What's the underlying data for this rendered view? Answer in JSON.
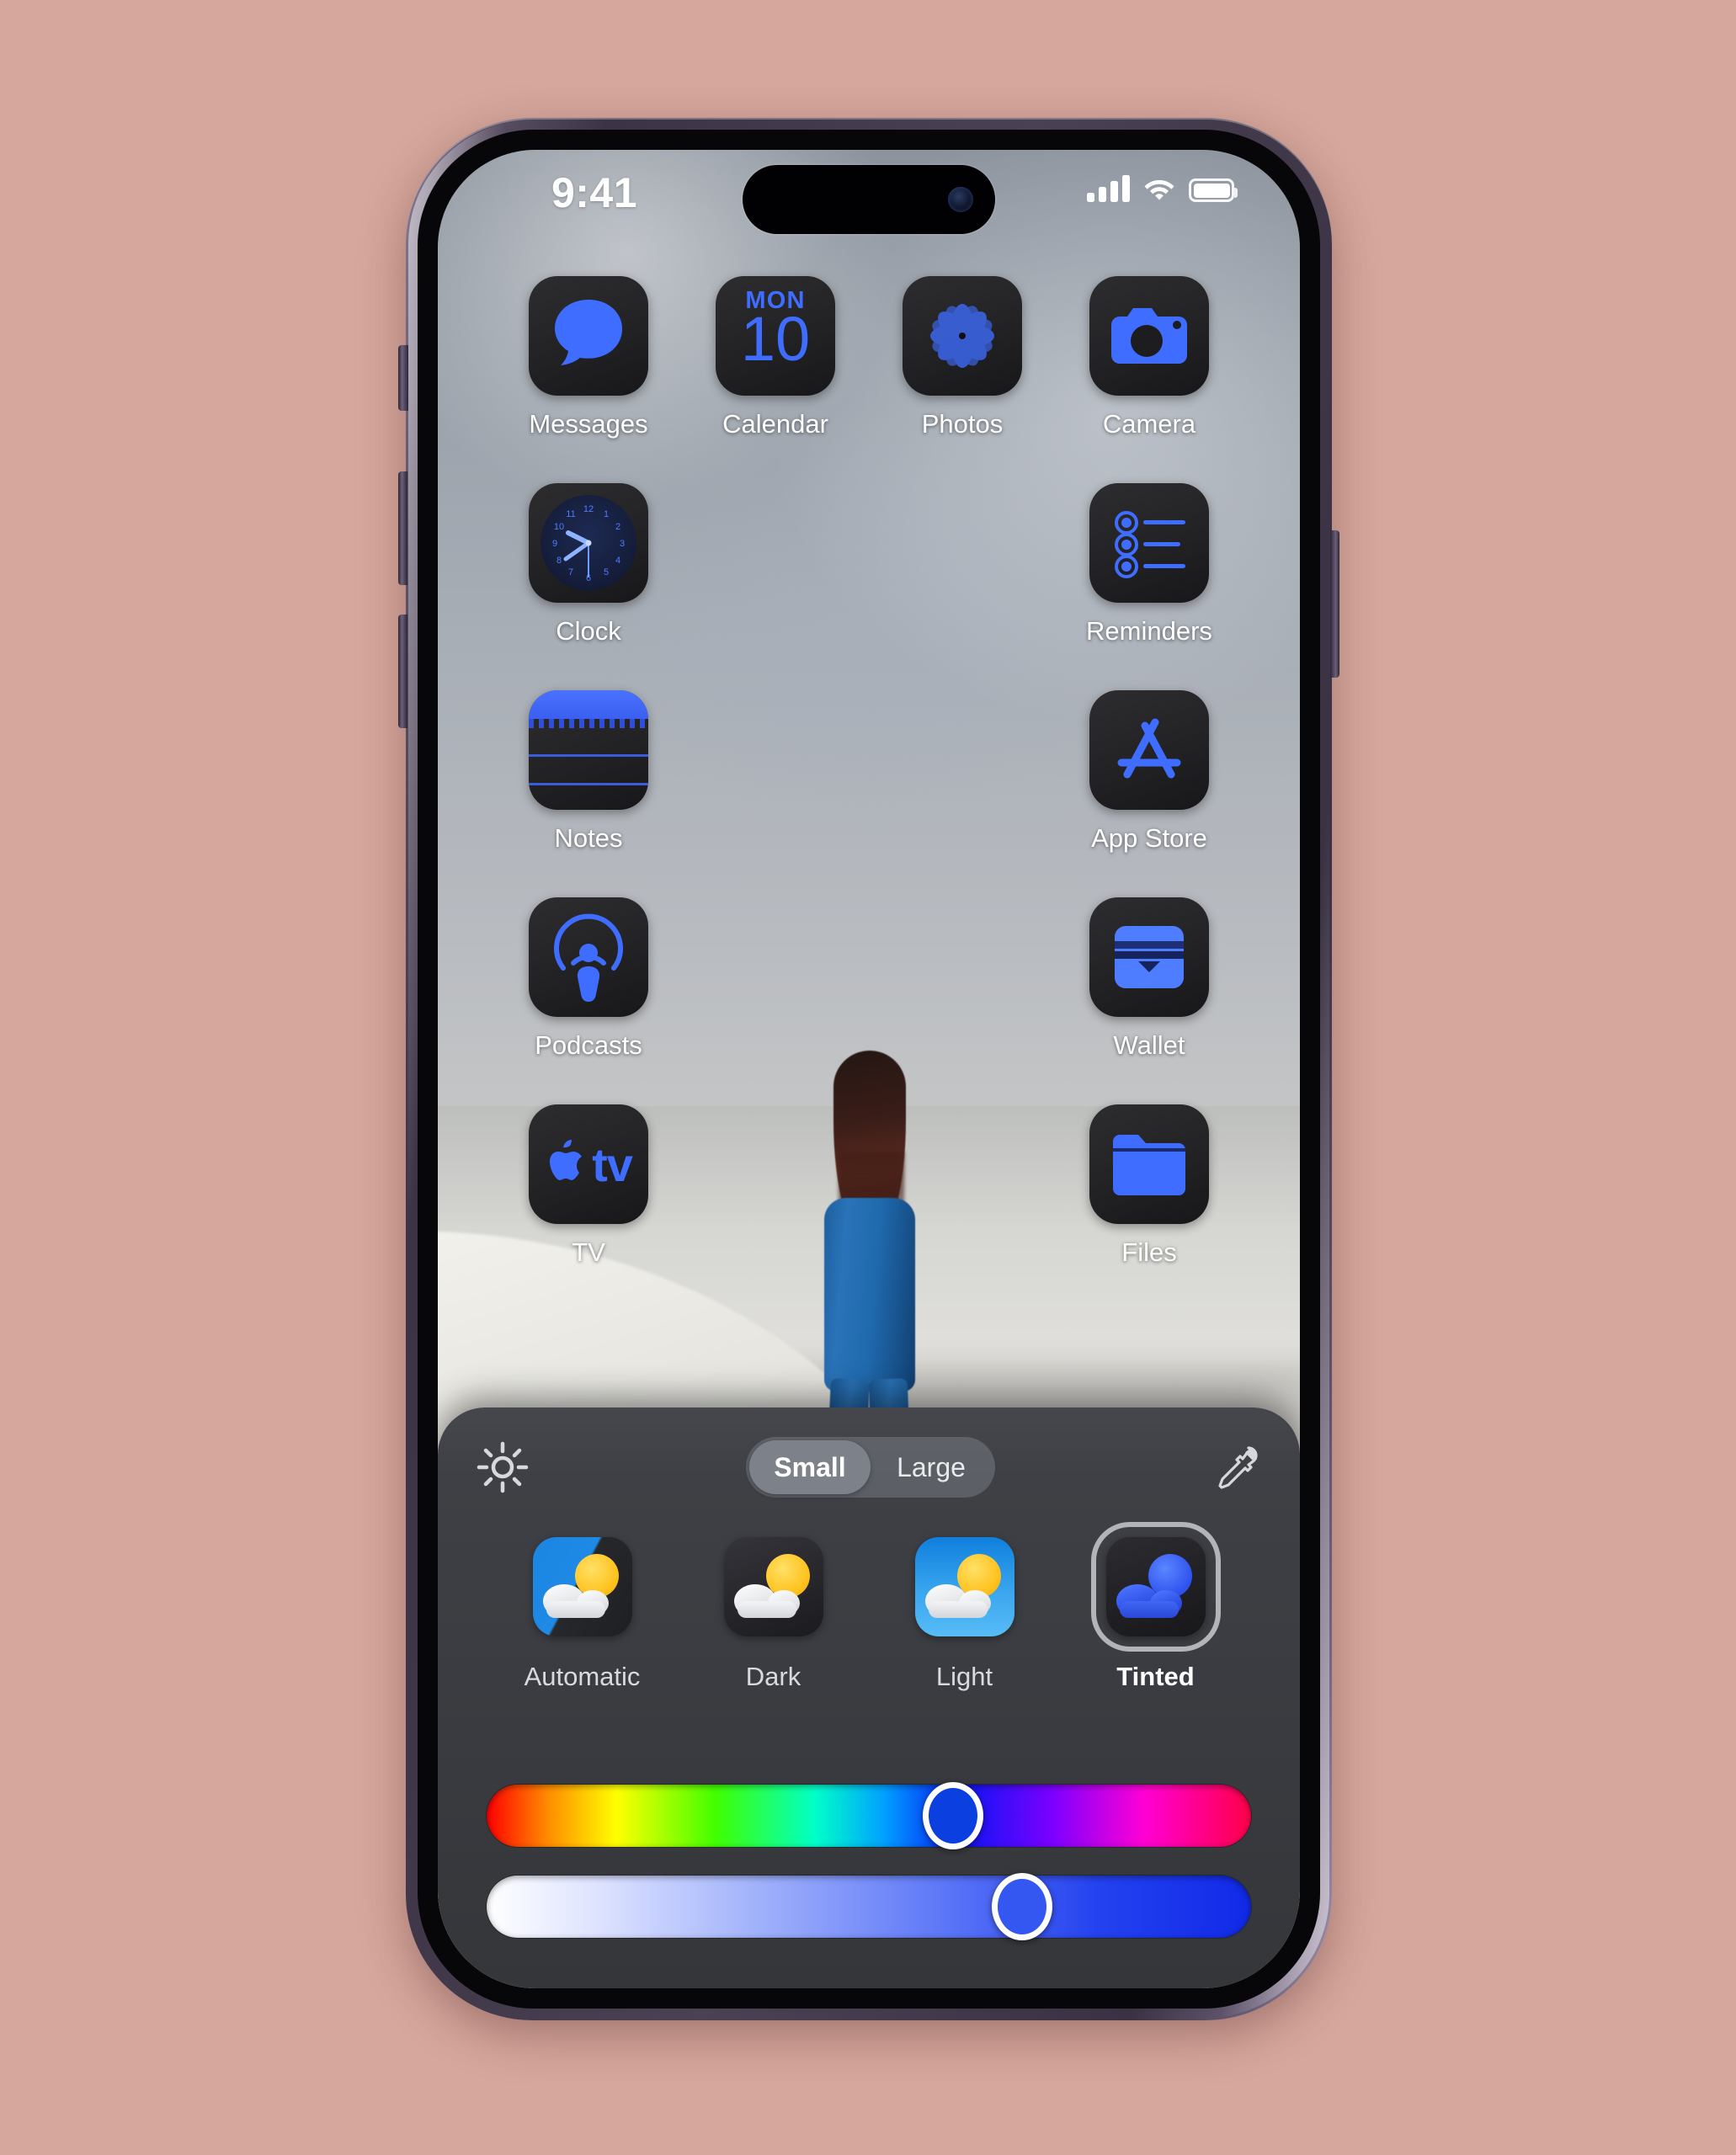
{
  "page": {
    "background_color": "#d6a79c",
    "device": "iPhone",
    "frame_color": "#3c3445"
  },
  "status_bar": {
    "time": "9:41",
    "signal_icon": "cellular-bars-icon",
    "wifi_icon": "wifi-icon",
    "battery_icon": "battery-full-icon",
    "battery_level": 100
  },
  "home_screen": {
    "wallpaper_description": "Person in blue suit walking on white sand dunes under cloudy sky",
    "icon_appearance": "Tinted",
    "accent_color": "#3f6dff",
    "rows": [
      [
        {
          "label": "Messages",
          "icon": "messages-icon"
        },
        {
          "label": "Calendar",
          "icon": "calendar-icon",
          "day_of_week": "MON",
          "day_number": "10"
        },
        {
          "label": "Photos",
          "icon": "photos-icon"
        },
        {
          "label": "Camera",
          "icon": "camera-icon"
        }
      ],
      [
        {
          "label": "Clock",
          "icon": "clock-icon"
        },
        {
          "label": "",
          "icon": ""
        },
        {
          "label": "",
          "icon": ""
        },
        {
          "label": "Reminders",
          "icon": "reminders-icon"
        }
      ],
      [
        {
          "label": "Notes",
          "icon": "notes-icon"
        },
        {
          "label": "",
          "icon": ""
        },
        {
          "label": "",
          "icon": ""
        },
        {
          "label": "App Store",
          "icon": "app-store-icon"
        }
      ],
      [
        {
          "label": "Podcasts",
          "icon": "podcasts-icon"
        },
        {
          "label": "",
          "icon": ""
        },
        {
          "label": "",
          "icon": ""
        },
        {
          "label": "Wallet",
          "icon": "wallet-icon"
        }
      ],
      [
        {
          "label": "TV",
          "icon": "apple-tv-icon",
          "apple_glyph": "",
          "word": "tv"
        },
        {
          "label": "",
          "icon": ""
        },
        {
          "label": "",
          "icon": ""
        },
        {
          "label": "Files",
          "icon": "files-icon"
        }
      ]
    ]
  },
  "appearance_panel": {
    "toolbar": {
      "brightness_icon": "brightness-sun-icon",
      "eyedropper_icon": "eyedropper-icon",
      "size_segment": {
        "options": [
          {
            "label": "Small",
            "selected": true
          },
          {
            "label": "Large",
            "selected": false
          }
        ],
        "selected_value": "Small"
      }
    },
    "modes": [
      {
        "label": "Automatic",
        "selected": false,
        "preview": "weather-icon-automatic"
      },
      {
        "label": "Dark",
        "selected": false,
        "preview": "weather-icon-dark"
      },
      {
        "label": "Light",
        "selected": false,
        "preview": "weather-icon-light"
      },
      {
        "label": "Tinted",
        "selected": true,
        "preview": "weather-icon-tinted"
      }
    ],
    "selected_mode": "Tinted",
    "sliders": [
      {
        "name": "hue-slider",
        "type": "hue",
        "value_percent": 61,
        "thumb_color": "#0b3fe0"
      },
      {
        "name": "saturation-slider",
        "type": "saturation",
        "value_percent": 70,
        "thumb_color": "#3457f2"
      }
    ]
  }
}
